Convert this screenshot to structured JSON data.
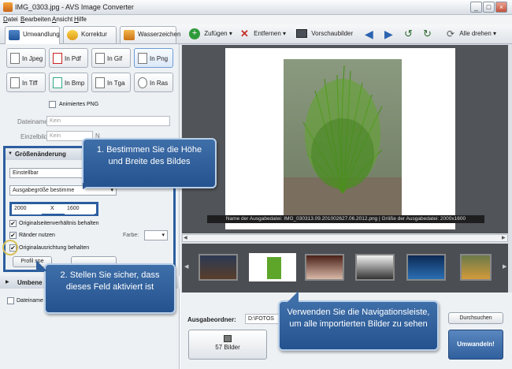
{
  "window": {
    "title": "IMG_0303.jpg - AVS Image Converter",
    "minimize": "_",
    "maximize": "□",
    "close": "×"
  },
  "menu": [
    {
      "key": "D",
      "rest": "atei"
    },
    {
      "key": "B",
      "rest": "earbeiten"
    },
    {
      "key": "A",
      "rest": "nsicht"
    },
    {
      "key": "H",
      "rest": "ilfe"
    }
  ],
  "tabs": {
    "conversion": "Umwandlung",
    "correction": "Korrektur",
    "watermark": "Wasserzeichen"
  },
  "toolbar": {
    "add": "Zufügen ▾",
    "remove": "Entfernen ▾",
    "previews": "Vorschaubilder",
    "rotate_all": "Alle drehen ▾"
  },
  "formats": [
    "In Jpeg",
    "In Pdf",
    "In Gif",
    "In Png",
    "In Tiff",
    "In Bmp",
    "In Tga",
    "In Ras"
  ],
  "selected_format": "In Png",
  "animated_png": "Animiertes PNG",
  "filename": {
    "label": "Dateiname:",
    "value": "Kein"
  },
  "single_image": {
    "label": "Einzelbild:",
    "value": "Kein",
    "cut_text": "N"
  },
  "resize": {
    "header": "Größenänderung",
    "preset": "Einstellbar",
    "output_size": "Ausgabegröße bestimme",
    "width": "2000",
    "times": "X",
    "height": "1600",
    "keep_ratio": "Originalseitenverhältnis behalten",
    "borders": "Ränder nutzen",
    "color_label": "Farbe:",
    "keep_orientation": "Originalausrichtung behalten",
    "profile_button": "Profil spe"
  },
  "rename_section": "Umbene",
  "dateinamen_cut": "Dateiname",
  "preview_caption": "Name der Ausgabedatei: IMG_030313.09.201002627.06.2012.png | Größe der Ausgabedatei: 2000x1600",
  "output": {
    "label": "Ausgabeordner:",
    "path": "D:\\FOTOS",
    "browse": "Durchsuchen"
  },
  "count_button": "57 Bilder",
  "convert_button": "Umwandeln!",
  "callouts": {
    "one": "1. Bestimmen Sie die Höhe und Breite des Bildes",
    "two": "2. Stellen Sie sicher, dass dieses Feld aktiviert ist",
    "three": "Verwenden Sie die Navigationsleiste, um alle importierten Bilder zu sehen"
  },
  "colors": {
    "accent_blue": "#2c5e9f",
    "callout_blue": "#2f5f9d",
    "convert_button": "#3a69a3",
    "add_green": "#2f9a3a",
    "remove_red": "#c43027"
  },
  "icons": [
    "app-icon",
    "add-icon",
    "remove-icon",
    "previews-icon",
    "back-arrow-icon",
    "forward-arrow-icon",
    "rotate-left-icon",
    "rotate-right-icon",
    "rotate-all-icon",
    "stack-icon"
  ]
}
